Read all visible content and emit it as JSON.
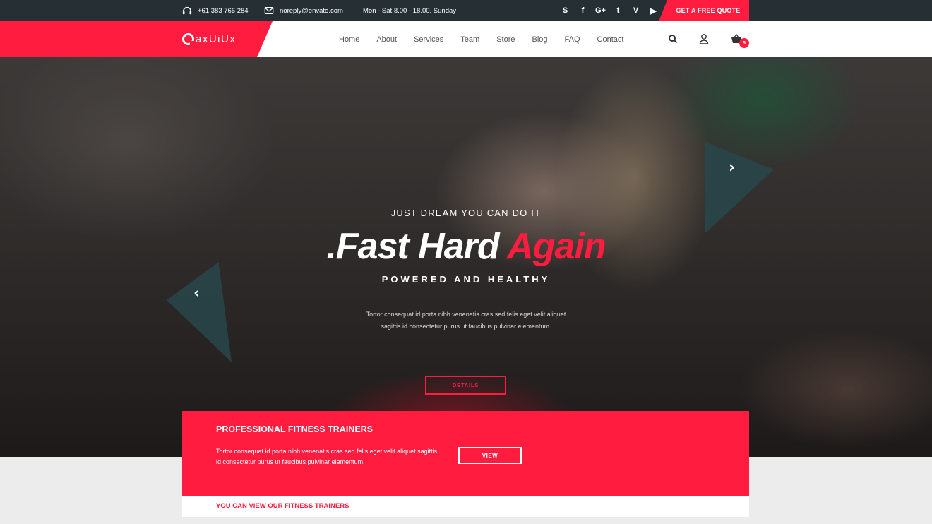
{
  "topbar": {
    "phone": "+61 383 766 284",
    "email": "noreply@envato.com",
    "hours": "Mon - Sat 8.00 - 18.00. Sunday",
    "social": [
      "S",
      "f",
      "G+",
      "t",
      "V",
      "▶"
    ],
    "quote_label": "GET A FREE QUOTE"
  },
  "header": {
    "logo_text": "axUiUx",
    "nav": [
      "Home",
      "About",
      "Services",
      "Team",
      "Store",
      "Blog",
      "FAQ",
      "Contact"
    ],
    "cart_count": "5"
  },
  "hero": {
    "subtitle": "JUST DREAM YOU CAN DO IT",
    "title_main": ".Fast Hard ",
    "title_accent": "Again",
    "tagline": "POWERED AND HEALTHY",
    "text": "Tortor consequat id porta nibh venenatis cras sed felis eget velit aliquet sagittis id consectetur purus ut faucibus pulvinar elementum.",
    "details_label": "DETAILS",
    "prev_glyph": "‹",
    "next_glyph": "›"
  },
  "trainers": {
    "title": "PROFESSIONAL FITNESS TRAINERS",
    "text": "Tortor consequat id porta nibh venenatis cras sed felis eget velit aliquet sagittis id consectetur purus ut faucibus pulvinar elementum.",
    "view_label": "VIEW",
    "footer_text": "YOU CAN VIEW OUR FITNESS TRAINERS"
  },
  "colors": {
    "accent": "#ff1c3f",
    "topbar": "#263034"
  }
}
